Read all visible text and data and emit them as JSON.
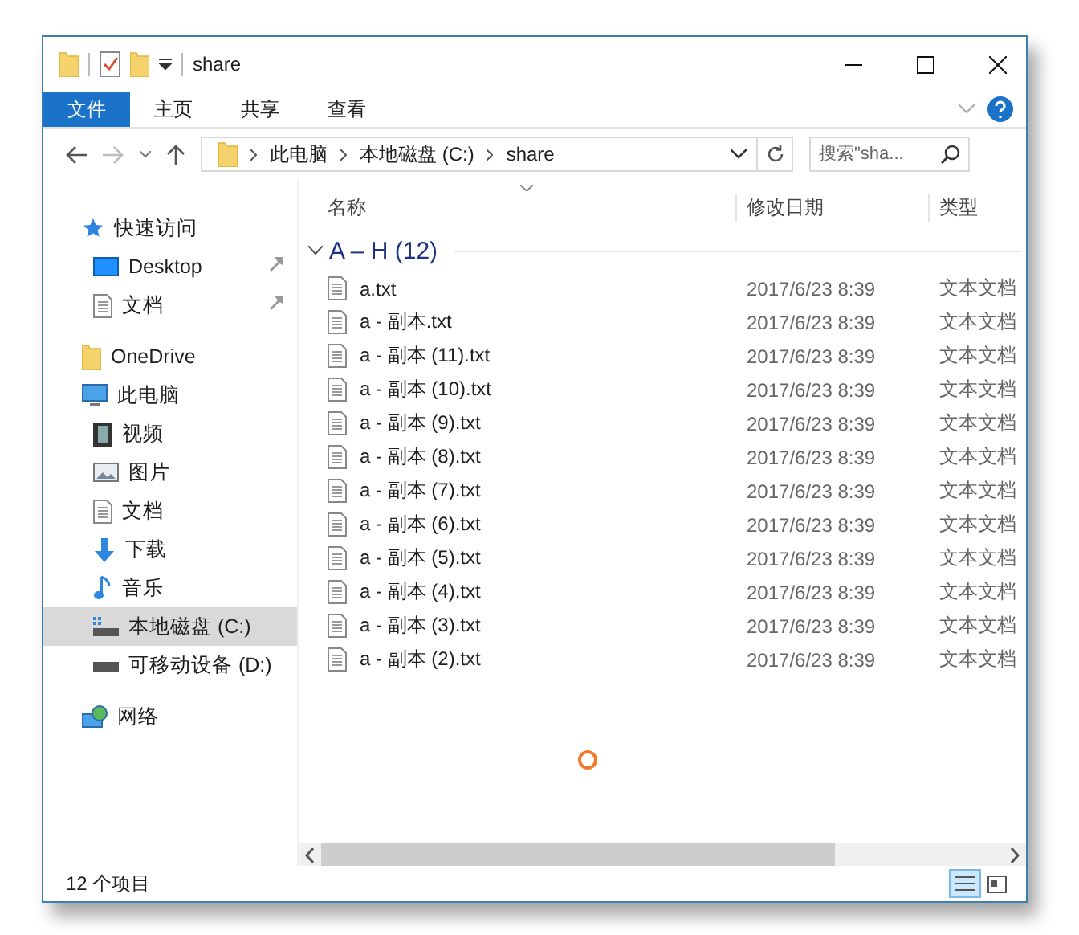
{
  "window": {
    "title": "share"
  },
  "ribbon_tabs": [
    {
      "label": "文件",
      "selected": true
    },
    {
      "label": "主页",
      "selected": false
    },
    {
      "label": "共享",
      "selected": false
    },
    {
      "label": "查看",
      "selected": false
    }
  ],
  "address": {
    "crumbs": [
      "此电脑",
      "本地磁盘 (C:)",
      "share"
    ]
  },
  "search": {
    "placeholder": "搜索\"sha..."
  },
  "nav": [
    {
      "label": "快速访问",
      "selected": false,
      "children": [
        {
          "label": "Desktop",
          "selected": false,
          "pinned": true
        },
        {
          "label": "文档",
          "selected": false,
          "pinned": true
        }
      ]
    },
    {
      "label": "OneDrive",
      "selected": false
    },
    {
      "label": "此电脑",
      "selected": false,
      "children": [
        {
          "label": "视频",
          "selected": false
        },
        {
          "label": "图片",
          "selected": false
        },
        {
          "label": "文档",
          "selected": false
        },
        {
          "label": "下载",
          "selected": false
        },
        {
          "label": "音乐",
          "selected": false
        },
        {
          "label": "本地磁盘 (C:)",
          "selected": true
        },
        {
          "label": "可移动设备 (D:)",
          "selected": false
        }
      ]
    },
    {
      "label": "网络",
      "selected": false
    }
  ],
  "columns": [
    "名称",
    "修改日期",
    "类型"
  ],
  "group": {
    "label": "A – H (12)",
    "expanded": true
  },
  "rows": [
    {
      "name": "a.txt",
      "date": "2017/6/23 8:39",
      "type": "文本文档"
    },
    {
      "name": "a - 副本.txt",
      "date": "2017/6/23 8:39",
      "type": "文本文档"
    },
    {
      "name": "a - 副本 (11).txt",
      "date": "2017/6/23 8:39",
      "type": "文本文档"
    },
    {
      "name": "a - 副本 (10).txt",
      "date": "2017/6/23 8:39",
      "type": "文本文档"
    },
    {
      "name": "a - 副本 (9).txt",
      "date": "2017/6/23 8:39",
      "type": "文本文档"
    },
    {
      "name": "a - 副本 (8).txt",
      "date": "2017/6/23 8:39",
      "type": "文本文档"
    },
    {
      "name": "a - 副本 (7).txt",
      "date": "2017/6/23 8:39",
      "type": "文本文档"
    },
    {
      "name": "a - 副本 (6).txt",
      "date": "2017/6/23 8:39",
      "type": "文本文档"
    },
    {
      "name": "a - 副本 (5).txt",
      "date": "2017/6/23 8:39",
      "type": "文本文档"
    },
    {
      "name": "a - 副本 (4).txt",
      "date": "2017/6/23 8:39",
      "type": "文本文档"
    },
    {
      "name": "a - 副本 (3).txt",
      "date": "2017/6/23 8:39",
      "type": "文本文档"
    },
    {
      "name": "a - 副本 (2).txt",
      "date": "2017/6/23 8:39",
      "type": "文本文档"
    }
  ],
  "status_bar": {
    "text": "12 个项目",
    "views": [
      {
        "kind": "details",
        "selected": true
      },
      {
        "kind": "tiles",
        "selected": false
      }
    ]
  }
}
